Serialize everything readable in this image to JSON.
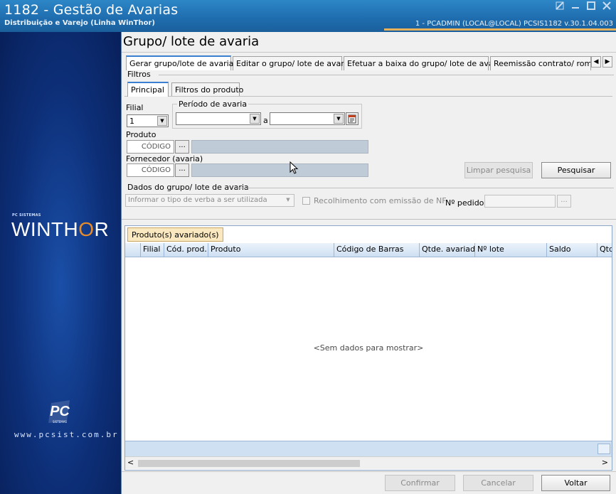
{
  "window": {
    "title": "1182 - Gestão de Avarias",
    "subtitle": "Distribuição e Varejo (Linha WinThor)",
    "session": "1 - PCADMIN (LOCAL@LOCAL)   PCSIS1182  v.30.1.04.003",
    "controls": [
      "restore-icon",
      "minimize-icon",
      "maximize-icon",
      "close-icon"
    ]
  },
  "sidebar": {
    "brand_small": "PC SISTEMAS",
    "brand_logo_a": "WINTH",
    "brand_logo_o": "O",
    "brand_logo_b": "R",
    "pc_logo_text": "PC",
    "pc_logo_sub": "SISTEMAS",
    "website": "www.pcsist.com.br"
  },
  "page": {
    "title": "Grupo/ lote de avaria",
    "tabs": [
      "Gerar grupo/lote de avaria",
      "Editar o grupo/ lote de avaria",
      "Efetuar a baixa do grupo/ lote de avaria",
      "Reemissão contrato/ romar"
    ]
  },
  "filters": {
    "legend": "Filtros",
    "subtabs": [
      "Principal",
      "Filtros do produto"
    ],
    "filial_label": "Filial",
    "filial_value": "1",
    "periodo_label": "Período de avaria",
    "periodo_sep": "a",
    "produto_label": "Produto",
    "produto_placeholder": "CÓDIGO",
    "fornecedor_label": "Fornecedor (avaria)",
    "fornecedor_placeholder": "CÓDIGO",
    "dots": "...",
    "clear_button": "Limpar pesquisa",
    "search_button": "Pesquisar"
  },
  "group_data": {
    "legend": "Dados do grupo/ lote de avaria",
    "verba_placeholder": "Informar o tipo de verba a ser utilizada",
    "recolhimento_label": "Recolhimento com emissão de NF",
    "pedido_label": "Nº pedido:",
    "dots": "..."
  },
  "grid": {
    "tab": "Produto(s) avariado(s)",
    "columns": [
      "Filial",
      "Cód. prod.",
      "Produto",
      "Código de Barras",
      "Qtde. avariada",
      "Nº lote",
      "Saldo",
      "Qtd"
    ],
    "empty_message": "<Sem dados para mostrar>",
    "scroll_left": "<",
    "scroll_right": ">"
  },
  "footer": {
    "confirm": "Confirmar",
    "cancel": "Cancelar",
    "back": "Voltar"
  },
  "colors": {
    "titlebar": "#1f6eb0",
    "sidebar": "#0d2f78",
    "accent_orange": "#e88c2a",
    "grid_header": "#cfe0f3",
    "grid_tab": "#f9e8c0"
  }
}
